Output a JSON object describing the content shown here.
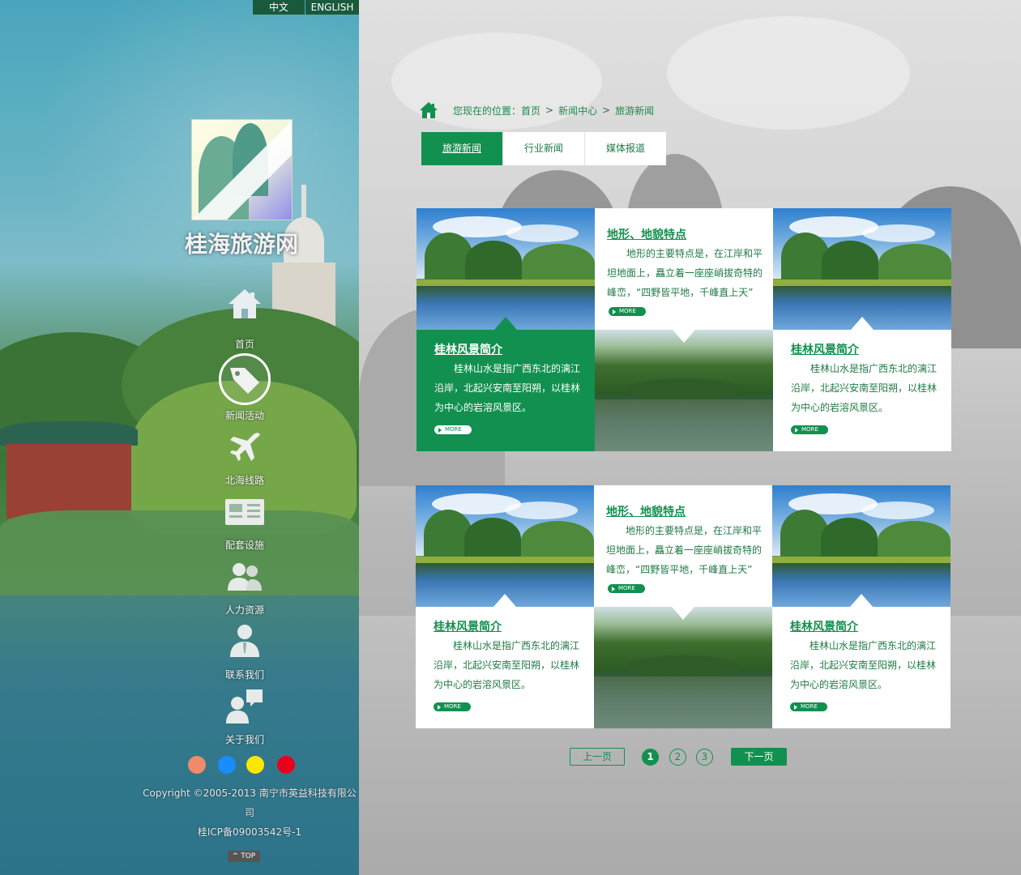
{
  "language_switch": {
    "cn": "中文",
    "en": "ENGLISH"
  },
  "site": {
    "title": "桂海旅游网"
  },
  "nav": [
    {
      "label": "首页",
      "icon": "home-icon"
    },
    {
      "label": "新闻活动",
      "icon": "tag-icon",
      "active": true
    },
    {
      "label": "北海线路",
      "icon": "airplane-icon"
    },
    {
      "label": "配套设施",
      "icon": "newspaper-icon"
    },
    {
      "label": "人力资源",
      "icon": "people-icon"
    },
    {
      "label": "联系我们",
      "icon": "contact-person-icon"
    },
    {
      "label": "关于我们",
      "icon": "chat-person-icon"
    }
  ],
  "color_dots": [
    "#f08a6a",
    "#1a8cff",
    "#ffe600",
    "#e8001c"
  ],
  "footer": {
    "copyright": "Copyright ©2005-2013 南宁市英益科技有限公司",
    "icp": "桂ICP备09003542号-1",
    "top_label": "TOP"
  },
  "breadcrumb": {
    "prefix": "您现在的位置：",
    "items": [
      "首页",
      "新闻中心",
      "旅游新闻"
    ],
    "separator": ">"
  },
  "tabs": [
    {
      "label": "旅游新闻",
      "active": true
    },
    {
      "label": "行业新闻",
      "active": false
    },
    {
      "label": "媒体报道",
      "active": false
    }
  ],
  "blocks": [
    {
      "feature": {
        "title": "地形、地貌特点",
        "text": "地形的主要特点是，在江岸和平坦地面上，矗立着一座座峭拔奇特的峰峦，“四野皆平地，千峰直上天”",
        "more": "MORE"
      },
      "left": {
        "title": "桂林风景简介",
        "text": "桂林山水是指广西东北的漓江沿岸，北起兴安南至阳朔，以桂林为中心的岩溶风景区。",
        "more": "MORE",
        "highlighted": true
      },
      "right": {
        "title": "桂林风景简介",
        "text": "桂林山水是指广西东北的漓江沿岸，北起兴安南至阳朔，以桂林为中心的岩溶风景区。",
        "more": "MORE",
        "highlighted": false
      }
    },
    {
      "feature": {
        "title": "地形、地貌特点",
        "text": "地形的主要特点是，在江岸和平坦地面上，矗立着一座座峭拔奇特的峰峦，“四野皆平地，千峰直上天”",
        "more": "MORE"
      },
      "left": {
        "title": "桂林风景简介",
        "text": "桂林山水是指广西东北的漓江沿岸，北起兴安南至阳朔，以桂林为中心的岩溶风景区。",
        "more": "MORE",
        "highlighted": false
      },
      "right": {
        "title": "桂林风景简介",
        "text": "桂林山水是指广西东北的漓江沿岸，北起兴安南至阳朔，以桂林为中心的岩溶风景区。",
        "more": "MORE",
        "highlighted": false
      }
    }
  ],
  "pagination": {
    "prev": "上一页",
    "next": "下一页",
    "pages": [
      "1",
      "2",
      "3"
    ],
    "current": "1"
  },
  "colors": {
    "accent": "#12904f",
    "lang_bar": "#1a5a3c"
  }
}
